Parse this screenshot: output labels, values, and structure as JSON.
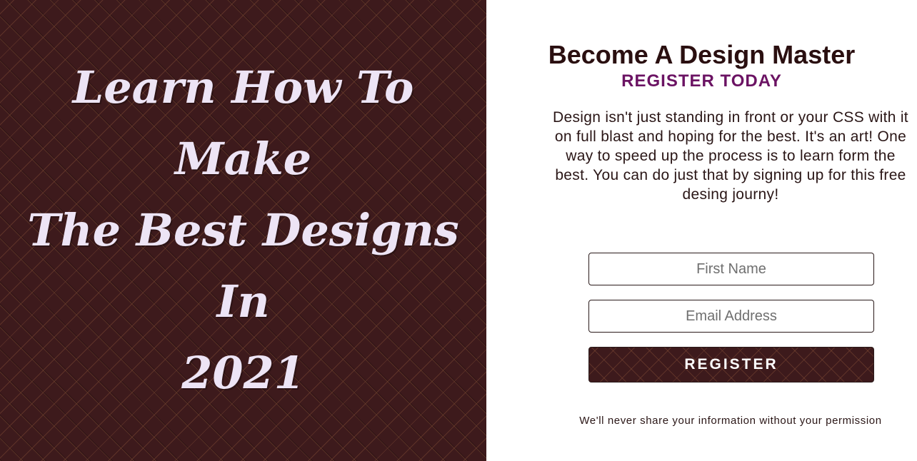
{
  "hero": {
    "title_lines": [
      "Learn How To Make",
      "The Best Designs In",
      "2021"
    ]
  },
  "form": {
    "title": "Become A Design Master",
    "subtitle": "REGISTER TODAY",
    "description": "Design isn't just standing in front or your CSS with it on full blast and hoping for the best. It's an art! One way to speed up the process is to learn form the best. You can do just that by signing up for this free desing journy!",
    "first_name_placeholder": "First Name",
    "email_placeholder": "Email Address",
    "register_label": "REGISTER",
    "disclaimer": "We'll never share your information without your permission"
  },
  "colors": {
    "hero_background": "#3d1a1c",
    "hero_text": "#ede4f5",
    "title_text": "#2a0f10",
    "subtitle_text": "#6b1363"
  }
}
